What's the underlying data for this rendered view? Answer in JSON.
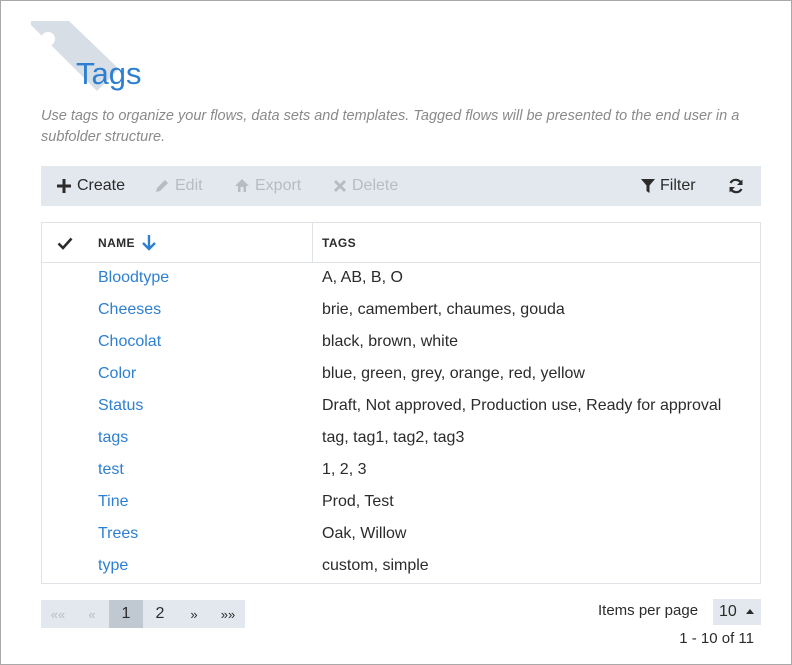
{
  "header": {
    "title": "Tags",
    "description": "Use tags to organize your flows, data sets and templates. Tagged flows will be presented to the end user in a subfolder structure."
  },
  "toolbar": {
    "create": "Create",
    "edit": "Edit",
    "export": "Export",
    "delete": "Delete",
    "filter": "Filter"
  },
  "grid": {
    "col_name": "NAME",
    "col_tags": "TAGS",
    "rows": [
      {
        "name": "Bloodtype",
        "tags": "A, AB, B, O"
      },
      {
        "name": "Cheeses",
        "tags": "brie, camembert, chaumes, gouda"
      },
      {
        "name": "Chocolat",
        "tags": "black, brown, white"
      },
      {
        "name": "Color",
        "tags": "blue, green, grey, orange, red, yellow"
      },
      {
        "name": "Status",
        "tags": "Draft, Not approved, Production use, Ready for approval"
      },
      {
        "name": "tags",
        "tags": "tag, tag1, tag2, tag3"
      },
      {
        "name": "test",
        "tags": "1, 2, 3"
      },
      {
        "name": "Tine",
        "tags": "Prod, Test"
      },
      {
        "name": "Trees",
        "tags": "Oak, Willow"
      },
      {
        "name": "type",
        "tags": "custom, simple"
      }
    ]
  },
  "pager": {
    "first": "««",
    "prev": "«",
    "pages": [
      "1",
      "2"
    ],
    "next": "»",
    "last": "»»",
    "items_per_page_label": "Items per page",
    "items_per_page_value": "10",
    "range": "1 - 10 of 11"
  },
  "colors": {
    "accent": "#2d7fd1",
    "toolbar_bg": "#e3e8ee",
    "disabled": "#b8bcc2"
  }
}
